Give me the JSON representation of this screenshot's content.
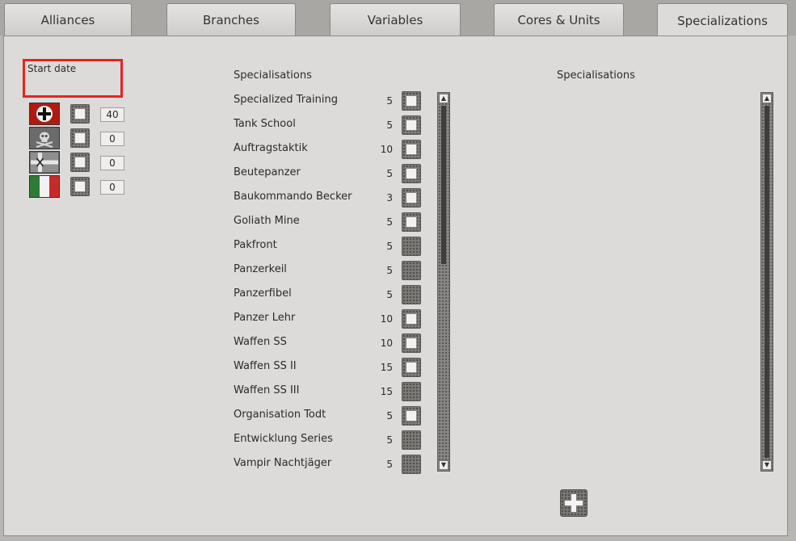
{
  "tabs": [
    {
      "label": "Alliances",
      "active": false
    },
    {
      "label": "Branches",
      "active": false
    },
    {
      "label": "Variables",
      "active": false
    },
    {
      "label": "Cores & Units",
      "active": false
    },
    {
      "label": "Specializations",
      "active": true
    }
  ],
  "left": {
    "start_date_label": "Start date",
    "factions": [
      {
        "icon": "iron-cross-icon",
        "value": "40"
      },
      {
        "icon": "skull-icon",
        "value": "0"
      },
      {
        "icon": "finland-flag-icon",
        "value": "0"
      },
      {
        "icon": "italy-flag-icon",
        "value": "0"
      }
    ]
  },
  "middle": {
    "heading": "Specialisations",
    "items": [
      {
        "name": "Specialized Training",
        "cost": "5",
        "checkbox": true
      },
      {
        "name": "Tank School",
        "cost": "5",
        "checkbox": true
      },
      {
        "name": "Auftragstaktik",
        "cost": "10",
        "checkbox": true
      },
      {
        "name": "Beutepanzer",
        "cost": "5",
        "checkbox": true
      },
      {
        "name": "Baukommando Becker",
        "cost": "3",
        "checkbox": true
      },
      {
        "name": "Goliath Mine",
        "cost": "5",
        "checkbox": true
      },
      {
        "name": "Pakfront",
        "cost": "5",
        "checkbox": false
      },
      {
        "name": "Panzerkeil",
        "cost": "5",
        "checkbox": false
      },
      {
        "name": "Panzerfibel",
        "cost": "5",
        "checkbox": false
      },
      {
        "name": "Panzer Lehr",
        "cost": "10",
        "checkbox": true
      },
      {
        "name": "Waffen SS",
        "cost": "10",
        "checkbox": true
      },
      {
        "name": "Waffen SS II",
        "cost": "15",
        "checkbox": true
      },
      {
        "name": "Waffen SS III",
        "cost": "15",
        "checkbox": false
      },
      {
        "name": "Organisation Todt",
        "cost": "5",
        "checkbox": true
      },
      {
        "name": "Entwicklung Series",
        "cost": "5",
        "checkbox": false
      },
      {
        "name": "Vampir Nachtjäger",
        "cost": "5",
        "checkbox": false
      }
    ]
  },
  "right": {
    "heading": "Specialisations"
  },
  "icons": {
    "scroll_up": "scroll-up-arrow-icon",
    "scroll_down": "scroll-down-arrow-icon",
    "add": "plus-icon"
  },
  "colors": {
    "highlight": "#e52420",
    "panel": "#dcdbd9"
  }
}
